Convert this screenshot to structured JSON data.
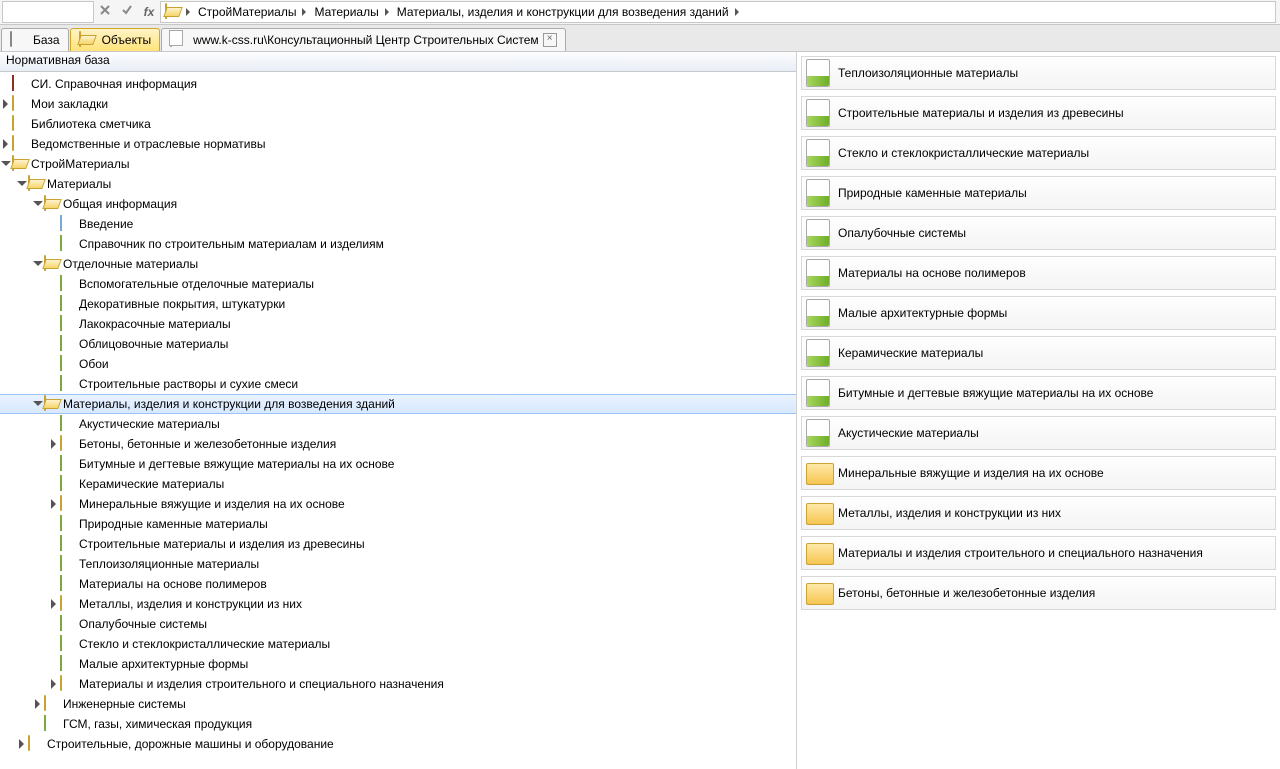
{
  "breadcrumb": {
    "items": [
      {
        "label": "СтройМатериалы"
      },
      {
        "label": "Материалы"
      },
      {
        "label": "Материалы, изделия и конструкции для возведения зданий"
      }
    ]
  },
  "tabs": {
    "base": "База",
    "objects": "Объекты",
    "web": "www.k-css.ru\\Консультационный Центр Строительных Систем"
  },
  "tree": {
    "header": "Нормативная база",
    "nodes": [
      {
        "depth": 0,
        "toggle": "none",
        "icon": "brick",
        "label": "СИ. Справочная информация"
      },
      {
        "depth": 0,
        "toggle": "closed",
        "icon": "folder",
        "label": "Мои закладки"
      },
      {
        "depth": 0,
        "toggle": "none",
        "icon": "folder",
        "label": "Библиотека сметчика"
      },
      {
        "depth": 0,
        "toggle": "closed",
        "icon": "folder",
        "label": "Ведомственные и отраслевые нормативы"
      },
      {
        "depth": 0,
        "toggle": "open",
        "icon": "folder-open",
        "label": "СтройМатериалы"
      },
      {
        "depth": 1,
        "toggle": "open",
        "icon": "folder-open",
        "label": "Материалы"
      },
      {
        "depth": 2,
        "toggle": "open",
        "icon": "folder-open",
        "label": "Общая информация"
      },
      {
        "depth": 3,
        "toggle": "none",
        "icon": "page-blue",
        "label": "Введение"
      },
      {
        "depth": 3,
        "toggle": "none",
        "icon": "page",
        "label": "Справочник по строительным материалам и изделиям"
      },
      {
        "depth": 2,
        "toggle": "open",
        "icon": "folder-open",
        "label": "Отделочные материалы"
      },
      {
        "depth": 3,
        "toggle": "none",
        "icon": "page",
        "label": "Вспомогательные отделочные материалы"
      },
      {
        "depth": 3,
        "toggle": "none",
        "icon": "page",
        "label": "Декоративные покрытия, штукатурки"
      },
      {
        "depth": 3,
        "toggle": "none",
        "icon": "page",
        "label": "Лакокрасочные материалы"
      },
      {
        "depth": 3,
        "toggle": "none",
        "icon": "page",
        "label": "Облицовочные материалы"
      },
      {
        "depth": 3,
        "toggle": "none",
        "icon": "page",
        "label": "Обои"
      },
      {
        "depth": 3,
        "toggle": "none",
        "icon": "page",
        "label": "Строительные растворы и сухие смеси"
      },
      {
        "depth": 2,
        "toggle": "open",
        "icon": "folder-open",
        "label": "Материалы, изделия и конструкции для возведения зданий",
        "selected": true
      },
      {
        "depth": 3,
        "toggle": "none",
        "icon": "page",
        "label": "Акустические материалы"
      },
      {
        "depth": 3,
        "toggle": "closed",
        "icon": "folder",
        "label": "Бетоны, бетонные и железобетонные изделия"
      },
      {
        "depth": 3,
        "toggle": "none",
        "icon": "page",
        "label": "Битумные и дегтевые вяжущие материалы на их основе"
      },
      {
        "depth": 3,
        "toggle": "none",
        "icon": "page",
        "label": "Керамические материалы"
      },
      {
        "depth": 3,
        "toggle": "closed",
        "icon": "folder",
        "label": "Минеральные вяжущие и изделия на их основе"
      },
      {
        "depth": 3,
        "toggle": "none",
        "icon": "page",
        "label": "Природные каменные материалы"
      },
      {
        "depth": 3,
        "toggle": "none",
        "icon": "page",
        "label": "Строительные материалы и изделия из древесины"
      },
      {
        "depth": 3,
        "toggle": "none",
        "icon": "page",
        "label": "Теплоизоляционные материалы"
      },
      {
        "depth": 3,
        "toggle": "none",
        "icon": "page",
        "label": "Материалы на основе полимеров"
      },
      {
        "depth": 3,
        "toggle": "closed",
        "icon": "folder",
        "label": "Металлы, изделия и конструкции из них"
      },
      {
        "depth": 3,
        "toggle": "none",
        "icon": "page",
        "label": "Опалубочные системы"
      },
      {
        "depth": 3,
        "toggle": "none",
        "icon": "page",
        "label": "Стекло и стеклокристаллические материалы"
      },
      {
        "depth": 3,
        "toggle": "none",
        "icon": "page",
        "label": "Малые архитектурные формы"
      },
      {
        "depth": 3,
        "toggle": "closed",
        "icon": "folder",
        "label": "Материалы и изделия строительного и специального назначения"
      },
      {
        "depth": 2,
        "toggle": "closed",
        "icon": "folder",
        "label": "Инженерные системы"
      },
      {
        "depth": 2,
        "toggle": "none",
        "icon": "page",
        "label": "ГСМ, газы, химическая продукция"
      },
      {
        "depth": 1,
        "toggle": "closed",
        "icon": "folder",
        "label": "Строительные, дорожные машины и оборудование"
      }
    ]
  },
  "cards": [
    {
      "icon": "doc",
      "label": "Теплоизоляционные материалы"
    },
    {
      "icon": "doc",
      "label": "Строительные материалы и изделия из древесины"
    },
    {
      "icon": "doc",
      "label": "Стекло и стеклокристаллические материалы"
    },
    {
      "icon": "doc",
      "label": "Природные каменные материалы"
    },
    {
      "icon": "doc",
      "label": "Опалубочные системы"
    },
    {
      "icon": "doc",
      "label": "Материалы на основе полимеров"
    },
    {
      "icon": "doc",
      "label": "Малые архитектурные формы"
    },
    {
      "icon": "doc",
      "label": "Керамические материалы"
    },
    {
      "icon": "doc",
      "label": "Битумные и дегтевые вяжущие материалы на их основе"
    },
    {
      "icon": "doc",
      "label": "Акустические материалы"
    },
    {
      "icon": "folder",
      "label": "Минеральные вяжущие и изделия на их основе"
    },
    {
      "icon": "folder",
      "label": "Металлы, изделия и конструкции из них"
    },
    {
      "icon": "folder",
      "label": "Материалы и изделия строительного и специального назначения"
    },
    {
      "icon": "folder",
      "label": "Бетоны, бетонные и железобетонные изделия"
    }
  ]
}
